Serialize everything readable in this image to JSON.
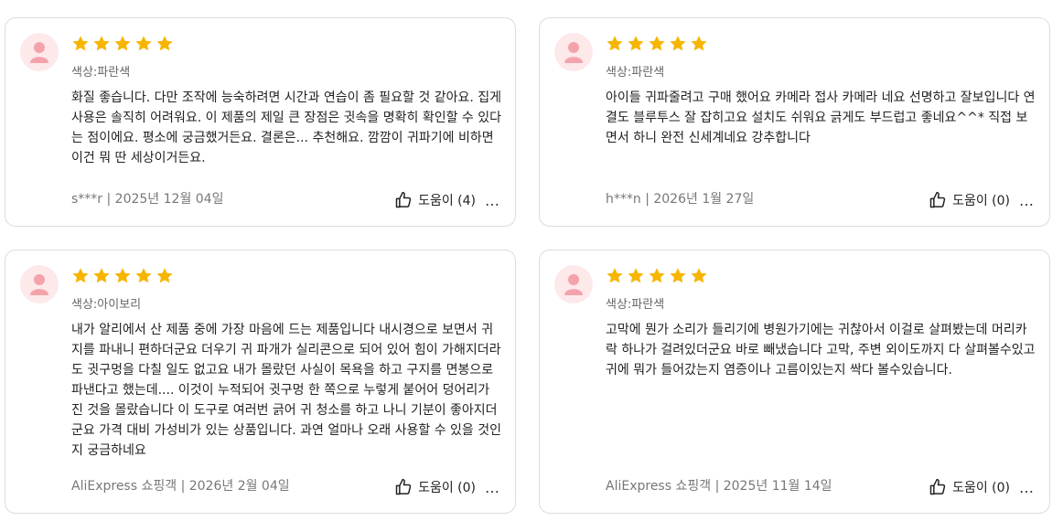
{
  "reviews": [
    {
      "variant": "색상:파란색",
      "text": "화질 좋습니다. 다만 조작에 능숙하려면 시간과 연습이 좀 필요할 것 같아요. 집게 사용은 솔직히 어려워요. 이 제품의 제일 큰 장점은 귓속을 명확히 확인할 수 있다는 점이에요. 평소에 궁금했거든요. 결론은... 추천해요. 깜깜이 귀파기에 비하면 이건 뭐 딴 세상이거든요.",
      "meta": "s***r | 2025년 12월 04일",
      "helpful": "도움이 (4)",
      "rating": 5
    },
    {
      "variant": "색상:파란색",
      "text": "아이들 귀파줄려고 구매 했어요 카메라 접사 카메라 네요 선명하고 잘보입니다 연결도 블루투스 잘 잡히고요 설치도 쉬워요 긁게도 부드럽고 좋네요^^* 직접 보면서 하니 완전 신세계네요 강추합니다",
      "meta": "h***n | 2026년 1월 27일",
      "helpful": "도움이 (0)",
      "rating": 5
    },
    {
      "variant": "색상:아이보리",
      "text": "내가 알리에서 산 제품 중에 가장 마음에 드는 제품입니다 내시경으로 보면서 귀지를 파내니 편하더군요 더우기 귀 파개가 실리콘으로 되어 있어 힘이 가해지더라도 귓구멍을 다칠 일도 없고요 내가 몰랐던 사실이 목욕을 하고 구지를 면봉으로 파낸다고 했는데.... 이것이 누적되어 귓구멍 한 쪽으로 누렇게 붙어어 덩어리가 진 것을 몰랐습니다 이 도구로 여러번 긁어 귀 청소를 하고 나니 기분이 좋아지더군요 가격 대비 가성비가 있는 상품입니다. 과연 얼마나 오래 사용할 수 있을 것인지 궁금하네요",
      "meta": "AliExpress 쇼핑객 | 2026년 2월 04일",
      "helpful": "도움이 (0)",
      "rating": 5
    },
    {
      "variant": "색상:파란색",
      "text": "고막에 뭔가 소리가 들리기에 병원가기에는 귀찮아서 이걸로 살펴봤는데 머리카락 하나가 걸려있더군요 바로 빼냈습니다 고막, 주변 외이도까지 다 살펴볼수있고 귀에 뭐가 들어갔는지 염증이나 고름이있는지 싹다 볼수있습니다.",
      "meta": "AliExpress 쇼핑객 | 2025년 11월 14일",
      "helpful": "도움이 (0)",
      "rating": 5
    }
  ],
  "more_icon": "…",
  "colors": {
    "star": "#f7b500",
    "avatar_bg": "#fde8ea",
    "avatar_fg": "#f4a3aa"
  }
}
